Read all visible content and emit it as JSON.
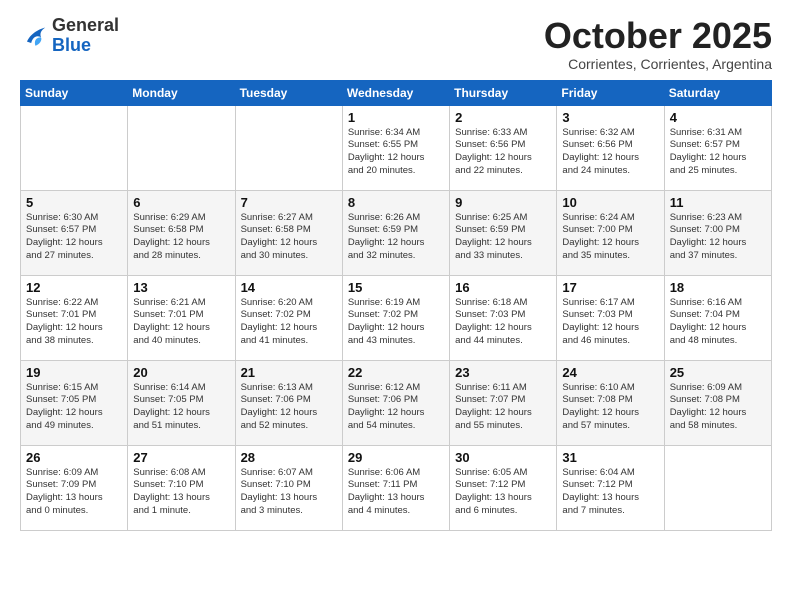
{
  "header": {
    "logo_general": "General",
    "logo_blue": "Blue",
    "month": "October 2025",
    "location": "Corrientes, Corrientes, Argentina"
  },
  "weekdays": [
    "Sunday",
    "Monday",
    "Tuesday",
    "Wednesday",
    "Thursday",
    "Friday",
    "Saturday"
  ],
  "weeks": [
    [
      {
        "day": "",
        "info": ""
      },
      {
        "day": "",
        "info": ""
      },
      {
        "day": "",
        "info": ""
      },
      {
        "day": "1",
        "info": "Sunrise: 6:34 AM\nSunset: 6:55 PM\nDaylight: 12 hours\nand 20 minutes."
      },
      {
        "day": "2",
        "info": "Sunrise: 6:33 AM\nSunset: 6:56 PM\nDaylight: 12 hours\nand 22 minutes."
      },
      {
        "day": "3",
        "info": "Sunrise: 6:32 AM\nSunset: 6:56 PM\nDaylight: 12 hours\nand 24 minutes."
      },
      {
        "day": "4",
        "info": "Sunrise: 6:31 AM\nSunset: 6:57 PM\nDaylight: 12 hours\nand 25 minutes."
      }
    ],
    [
      {
        "day": "5",
        "info": "Sunrise: 6:30 AM\nSunset: 6:57 PM\nDaylight: 12 hours\nand 27 minutes."
      },
      {
        "day": "6",
        "info": "Sunrise: 6:29 AM\nSunset: 6:58 PM\nDaylight: 12 hours\nand 28 minutes."
      },
      {
        "day": "7",
        "info": "Sunrise: 6:27 AM\nSunset: 6:58 PM\nDaylight: 12 hours\nand 30 minutes."
      },
      {
        "day": "8",
        "info": "Sunrise: 6:26 AM\nSunset: 6:59 PM\nDaylight: 12 hours\nand 32 minutes."
      },
      {
        "day": "9",
        "info": "Sunrise: 6:25 AM\nSunset: 6:59 PM\nDaylight: 12 hours\nand 33 minutes."
      },
      {
        "day": "10",
        "info": "Sunrise: 6:24 AM\nSunset: 7:00 PM\nDaylight: 12 hours\nand 35 minutes."
      },
      {
        "day": "11",
        "info": "Sunrise: 6:23 AM\nSunset: 7:00 PM\nDaylight: 12 hours\nand 37 minutes."
      }
    ],
    [
      {
        "day": "12",
        "info": "Sunrise: 6:22 AM\nSunset: 7:01 PM\nDaylight: 12 hours\nand 38 minutes."
      },
      {
        "day": "13",
        "info": "Sunrise: 6:21 AM\nSunset: 7:01 PM\nDaylight: 12 hours\nand 40 minutes."
      },
      {
        "day": "14",
        "info": "Sunrise: 6:20 AM\nSunset: 7:02 PM\nDaylight: 12 hours\nand 41 minutes."
      },
      {
        "day": "15",
        "info": "Sunrise: 6:19 AM\nSunset: 7:02 PM\nDaylight: 12 hours\nand 43 minutes."
      },
      {
        "day": "16",
        "info": "Sunrise: 6:18 AM\nSunset: 7:03 PM\nDaylight: 12 hours\nand 44 minutes."
      },
      {
        "day": "17",
        "info": "Sunrise: 6:17 AM\nSunset: 7:03 PM\nDaylight: 12 hours\nand 46 minutes."
      },
      {
        "day": "18",
        "info": "Sunrise: 6:16 AM\nSunset: 7:04 PM\nDaylight: 12 hours\nand 48 minutes."
      }
    ],
    [
      {
        "day": "19",
        "info": "Sunrise: 6:15 AM\nSunset: 7:05 PM\nDaylight: 12 hours\nand 49 minutes."
      },
      {
        "day": "20",
        "info": "Sunrise: 6:14 AM\nSunset: 7:05 PM\nDaylight: 12 hours\nand 51 minutes."
      },
      {
        "day": "21",
        "info": "Sunrise: 6:13 AM\nSunset: 7:06 PM\nDaylight: 12 hours\nand 52 minutes."
      },
      {
        "day": "22",
        "info": "Sunrise: 6:12 AM\nSunset: 7:06 PM\nDaylight: 12 hours\nand 54 minutes."
      },
      {
        "day": "23",
        "info": "Sunrise: 6:11 AM\nSunset: 7:07 PM\nDaylight: 12 hours\nand 55 minutes."
      },
      {
        "day": "24",
        "info": "Sunrise: 6:10 AM\nSunset: 7:08 PM\nDaylight: 12 hours\nand 57 minutes."
      },
      {
        "day": "25",
        "info": "Sunrise: 6:09 AM\nSunset: 7:08 PM\nDaylight: 12 hours\nand 58 minutes."
      }
    ],
    [
      {
        "day": "26",
        "info": "Sunrise: 6:09 AM\nSunset: 7:09 PM\nDaylight: 13 hours\nand 0 minutes."
      },
      {
        "day": "27",
        "info": "Sunrise: 6:08 AM\nSunset: 7:10 PM\nDaylight: 13 hours\nand 1 minute."
      },
      {
        "day": "28",
        "info": "Sunrise: 6:07 AM\nSunset: 7:10 PM\nDaylight: 13 hours\nand 3 minutes."
      },
      {
        "day": "29",
        "info": "Sunrise: 6:06 AM\nSunset: 7:11 PM\nDaylight: 13 hours\nand 4 minutes."
      },
      {
        "day": "30",
        "info": "Sunrise: 6:05 AM\nSunset: 7:12 PM\nDaylight: 13 hours\nand 6 minutes."
      },
      {
        "day": "31",
        "info": "Sunrise: 6:04 AM\nSunset: 7:12 PM\nDaylight: 13 hours\nand 7 minutes."
      },
      {
        "day": "",
        "info": ""
      }
    ]
  ]
}
